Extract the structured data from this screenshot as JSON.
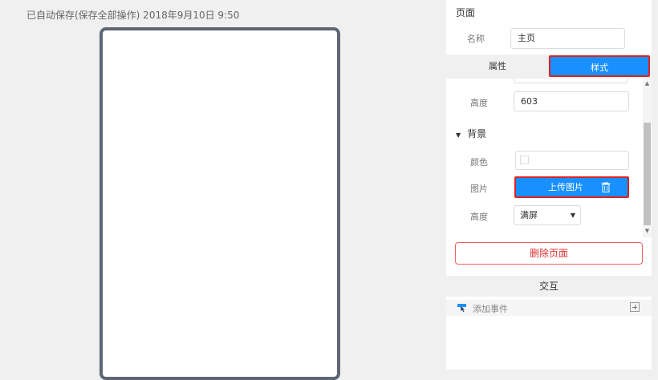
{
  "autosave_status": "已自动保存(保存全部操作) 2018年9月10日 9:50",
  "panel": {
    "title": "页面",
    "name_label": "名称",
    "name_value": "主页",
    "tabs": [
      {
        "label": "属性",
        "active": false
      },
      {
        "label": "样式",
        "active": true
      }
    ],
    "height_label": "高度",
    "height_value": "603",
    "background": {
      "section_label": "背景",
      "color_label": "颜色",
      "image_label": "图片",
      "upload_label": "上传图片",
      "trash_icon": "trash-icon",
      "bg_height_label": "高度",
      "bg_height_selected": "满屏"
    },
    "delete_label": "删除页面",
    "interaction": {
      "header": "交互",
      "add_event_label": "添加事件"
    }
  },
  "colors": {
    "accent": "#1890ff",
    "highlight_border": "#e02020",
    "danger": "#e03030",
    "phone_frame": "#5e6776"
  }
}
